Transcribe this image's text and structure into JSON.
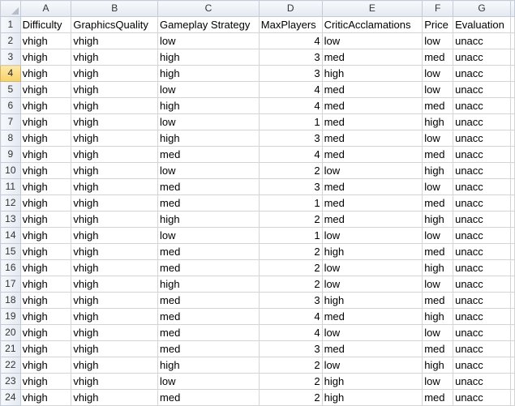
{
  "columns": [
    {
      "letter": "A"
    },
    {
      "letter": "B"
    },
    {
      "letter": "C"
    },
    {
      "letter": "D"
    },
    {
      "letter": "E"
    },
    {
      "letter": "F"
    },
    {
      "letter": "G"
    }
  ],
  "selected_row": "4",
  "rows": [
    {
      "num": "1",
      "cells": [
        "Difficulty",
        "GraphicsQuality",
        "Gameplay Strategy",
        "MaxPlayers",
        "CriticAcclamations",
        "Price",
        "Evaluation"
      ]
    },
    {
      "num": "2",
      "cells": [
        "vhigh",
        "vhigh",
        "low",
        "4",
        "low",
        "low",
        "unacc"
      ]
    },
    {
      "num": "3",
      "cells": [
        "vhigh",
        "vhigh",
        "high",
        "3",
        "med",
        "med",
        "unacc"
      ]
    },
    {
      "num": "4",
      "cells": [
        "vhigh",
        "vhigh",
        "high",
        "3",
        "high",
        "low",
        "unacc"
      ]
    },
    {
      "num": "5",
      "cells": [
        "vhigh",
        "vhigh",
        "low",
        "4",
        "med",
        "low",
        "unacc"
      ]
    },
    {
      "num": "6",
      "cells": [
        "vhigh",
        "vhigh",
        "high",
        "4",
        "med",
        "med",
        "unacc"
      ]
    },
    {
      "num": "7",
      "cells": [
        "vhigh",
        "vhigh",
        "low",
        "1",
        "med",
        "high",
        "unacc"
      ]
    },
    {
      "num": "8",
      "cells": [
        "vhigh",
        "vhigh",
        "high",
        "3",
        "med",
        "low",
        "unacc"
      ]
    },
    {
      "num": "9",
      "cells": [
        "vhigh",
        "vhigh",
        "med",
        "4",
        "med",
        "med",
        "unacc"
      ]
    },
    {
      "num": "10",
      "cells": [
        "vhigh",
        "vhigh",
        "low",
        "2",
        "low",
        "high",
        "unacc"
      ]
    },
    {
      "num": "11",
      "cells": [
        "vhigh",
        "vhigh",
        "med",
        "3",
        "med",
        "low",
        "unacc"
      ]
    },
    {
      "num": "12",
      "cells": [
        "vhigh",
        "vhigh",
        "med",
        "1",
        "med",
        "med",
        "unacc"
      ]
    },
    {
      "num": "13",
      "cells": [
        "vhigh",
        "vhigh",
        "high",
        "2",
        "med",
        "high",
        "unacc"
      ]
    },
    {
      "num": "14",
      "cells": [
        "vhigh",
        "vhigh",
        "low",
        "1",
        "low",
        "low",
        "unacc"
      ]
    },
    {
      "num": "15",
      "cells": [
        "vhigh",
        "vhigh",
        "med",
        "2",
        "high",
        "med",
        "unacc"
      ]
    },
    {
      "num": "16",
      "cells": [
        "vhigh",
        "vhigh",
        "med",
        "2",
        "low",
        "high",
        "unacc"
      ]
    },
    {
      "num": "17",
      "cells": [
        "vhigh",
        "vhigh",
        "high",
        "2",
        "low",
        "low",
        "unacc"
      ]
    },
    {
      "num": "18",
      "cells": [
        "vhigh",
        "vhigh",
        "med",
        "3",
        "high",
        "med",
        "unacc"
      ]
    },
    {
      "num": "19",
      "cells": [
        "vhigh",
        "vhigh",
        "med",
        "4",
        "med",
        "high",
        "unacc"
      ]
    },
    {
      "num": "20",
      "cells": [
        "vhigh",
        "vhigh",
        "med",
        "4",
        "low",
        "low",
        "unacc"
      ]
    },
    {
      "num": "21",
      "cells": [
        "vhigh",
        "vhigh",
        "med",
        "3",
        "med",
        "med",
        "unacc"
      ]
    },
    {
      "num": "22",
      "cells": [
        "vhigh",
        "vhigh",
        "high",
        "2",
        "low",
        "high",
        "unacc"
      ]
    },
    {
      "num": "23",
      "cells": [
        "vhigh",
        "vhigh",
        "low",
        "2",
        "high",
        "low",
        "unacc"
      ]
    },
    {
      "num": "24",
      "cells": [
        "vhigh",
        "vhigh",
        "med",
        "2",
        "high",
        "med",
        "unacc"
      ]
    }
  ]
}
